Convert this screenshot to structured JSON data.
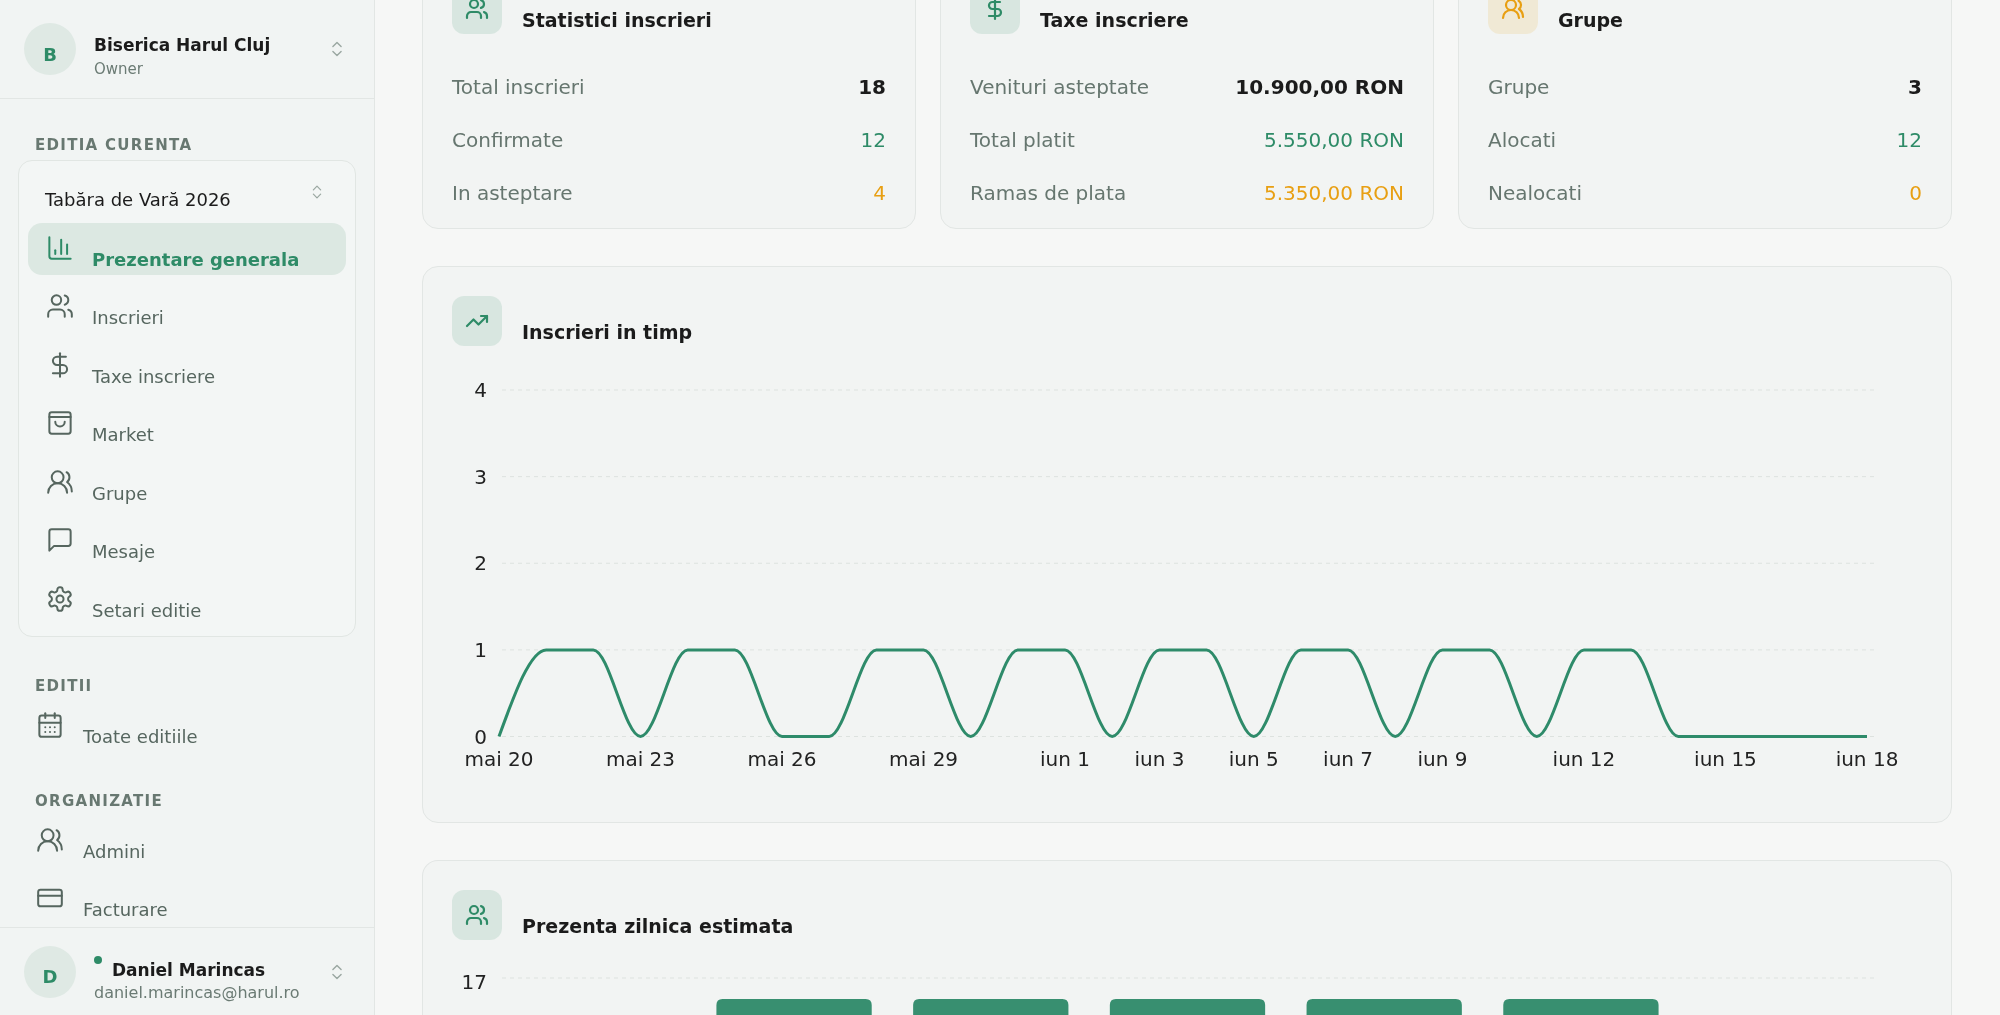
{
  "sidebar": {
    "organization": {
      "avatar_letter": "B",
      "name": "Biserica Harul Cluj",
      "role": "Owner"
    },
    "sections": [
      {
        "heading": "EDITIA CURENTA",
        "edition": "Tabăra de Vară 2026",
        "items": [
          {
            "label": "Prezentare generala",
            "selected": true
          },
          {
            "label": "Inscrieri",
            "selected": false
          },
          {
            "label": "Taxe inscriere",
            "selected": false
          },
          {
            "label": "Market",
            "selected": false
          },
          {
            "label": "Grupe",
            "selected": false
          },
          {
            "label": "Mesaje",
            "selected": false
          },
          {
            "label": "Setari editie",
            "selected": false
          }
        ]
      },
      {
        "heading": "EDITII",
        "items": [
          {
            "label": "Toate editiile",
            "selected": false
          }
        ]
      },
      {
        "heading": "ORGANIZATIE",
        "items": [
          {
            "label": "Admini",
            "selected": false
          },
          {
            "label": "Facturare",
            "selected": false
          }
        ]
      }
    ],
    "user": {
      "avatar_letter": "D",
      "name": "Daniel Marincas",
      "email": "daniel.marincas@harul.ro",
      "online": true
    }
  },
  "stat_cards": [
    {
      "title": "Statistici inscrieri",
      "color": "#2e8b67",
      "rows": [
        {
          "label": "Total inscrieri",
          "value": "18",
          "kind": "total",
          "color": "#1b1b1b"
        },
        {
          "label": "Confirmate",
          "value": "12",
          "kind": "part",
          "color": "#2e8b67"
        },
        {
          "label": "In asteptare",
          "value": "4",
          "kind": "part",
          "color": "#e89f12"
        }
      ]
    },
    {
      "title": "Taxe inscriere",
      "color": "#2e8b67",
      "rows": [
        {
          "label": "Venituri asteptate",
          "value": "10.900,00 RON",
          "kind": "total",
          "color": "#1b1b1b"
        },
        {
          "label": "Total platit",
          "value": "5.550,00 RON",
          "kind": "part",
          "color": "#2e8b67"
        },
        {
          "label": "Ramas de plata",
          "value": "5.350,00 RON",
          "kind": "part",
          "color": "#e89f12"
        }
      ]
    },
    {
      "title": "Grupe",
      "color": "#e89f12",
      "rows": [
        {
          "label": "Grupe",
          "value": "3",
          "kind": "total",
          "color": "#1b1b1b"
        },
        {
          "label": "Alocati",
          "value": "12",
          "kind": "part",
          "color": "#2e8b67"
        },
        {
          "label": "Nealocati",
          "value": "0",
          "kind": "part",
          "color": "#e89f12"
        }
      ]
    }
  ],
  "timeline_card": {
    "title": "Inscrieri in timp",
    "chart_data": {
      "type": "line",
      "categories": [
        "mai 20",
        null,
        null,
        "mai 23",
        null,
        null,
        "mai 26",
        null,
        null,
        "mai 29",
        null,
        null,
        "iun 1",
        null,
        "iun 3",
        null,
        "iun 5",
        null,
        "iun 7",
        null,
        "iun 9",
        null,
        null,
        "iun 12",
        null,
        null,
        "iun 15",
        null,
        null,
        "iun 18"
      ],
      "values": [
        0,
        1,
        1,
        0,
        1,
        1,
        0,
        0,
        1,
        1,
        0,
        1,
        1,
        0,
        1,
        1,
        0,
        1,
        1,
        0,
        1,
        1,
        0,
        1,
        1,
        0,
        0,
        0,
        0,
        0
      ],
      "ylim": [
        0,
        4
      ],
      "yticks": [
        0,
        1,
        2,
        3,
        4
      ],
      "grid": true
    }
  },
  "attendance_card": {
    "title": "Prezenta zilnica estimata",
    "y_tick_labels": [
      "17"
    ]
  }
}
